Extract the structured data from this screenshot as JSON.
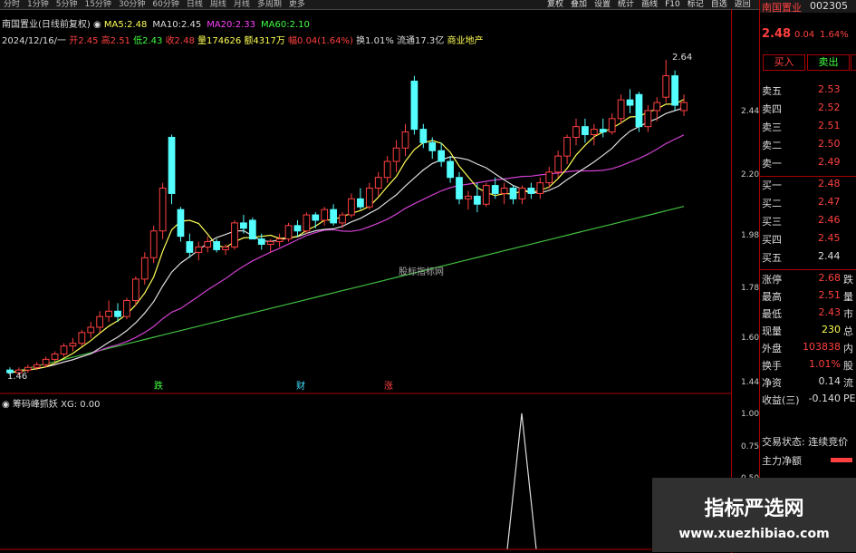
{
  "topbar": {
    "periods": [
      "分时",
      "1分钟",
      "5分钟",
      "15分钟",
      "30分钟",
      "60分钟",
      "日线",
      "周线",
      "月线",
      "多周期",
      "更多"
    ],
    "right_buttons": [
      "复权",
      "叠加",
      "设置",
      "统计",
      "画线",
      "F10",
      "标记",
      "自选",
      "返回"
    ]
  },
  "chart_header": {
    "title": "南国置业(日线前复权)",
    "ma_line": [
      {
        "label": "MA5:",
        "value": "2.48",
        "color": "#ffff55"
      },
      {
        "label": "MA10:",
        "value": "2.45",
        "color": "#dddddd"
      },
      {
        "label": "MA20:",
        "value": "2.33",
        "color": "#ff40ff"
      },
      {
        "label": "MA60:",
        "value": "2.10",
        "color": "#40ff40"
      }
    ],
    "info_line": {
      "date": "2024/12/16/一",
      "open": "开2.45",
      "high": "高2.51",
      "low": "低2.43",
      "close": "收2.48",
      "volume": "量174626",
      "amount": "额4317万",
      "change": "幅0.04(1.64%)",
      "turnover": "换1.01%",
      "float": "流通17.3亿",
      "sector": "商业地产"
    }
  },
  "chart_annotations": {
    "high_label": "2.64",
    "low_label": "1.46",
    "center_watermark": "股标指标网",
    "markers": [
      "跌",
      "财",
      "涨"
    ]
  },
  "y_axis_main": [
    "2.44",
    "2.20",
    "1.98",
    "1.78",
    "1.60",
    "1.44"
  ],
  "y_axis_sub": [
    "1.00",
    "0.75",
    "0.50"
  ],
  "sub_indicator": {
    "name": "筹码峰抓妖",
    "value": "XG: 0.00"
  },
  "chart_data": {
    "type": "candlestick",
    "y_range": [
      1.44,
      2.66
    ],
    "candles": [
      [
        1.48,
        1.49,
        1.46,
        1.47
      ],
      [
        1.47,
        1.49,
        1.46,
        1.48
      ],
      [
        1.48,
        1.5,
        1.47,
        1.49
      ],
      [
        1.49,
        1.51,
        1.48,
        1.5
      ],
      [
        1.5,
        1.53,
        1.49,
        1.52
      ],
      [
        1.52,
        1.55,
        1.51,
        1.54
      ],
      [
        1.54,
        1.58,
        1.53,
        1.57
      ],
      [
        1.57,
        1.6,
        1.55,
        1.58
      ],
      [
        1.58,
        1.63,
        1.57,
        1.62
      ],
      [
        1.62,
        1.66,
        1.6,
        1.64
      ],
      [
        1.64,
        1.7,
        1.62,
        1.68
      ],
      [
        1.68,
        1.74,
        1.66,
        1.7
      ],
      [
        1.7,
        1.73,
        1.66,
        1.68
      ],
      [
        1.68,
        1.75,
        1.67,
        1.74
      ],
      [
        1.74,
        1.83,
        1.72,
        1.82
      ],
      [
        1.82,
        1.92,
        1.8,
        1.9
      ],
      [
        1.9,
        2.02,
        1.88,
        2.0
      ],
      [
        2.0,
        2.18,
        1.97,
        2.16
      ],
      [
        2.35,
        2.36,
        2.1,
        2.14
      ],
      [
        2.08,
        2.09,
        1.96,
        1.98
      ],
      [
        1.96,
        1.99,
        1.9,
        1.92
      ],
      [
        1.92,
        1.96,
        1.89,
        1.94
      ],
      [
        1.94,
        1.98,
        1.92,
        1.96
      ],
      [
        1.96,
        1.97,
        1.92,
        1.93
      ],
      [
        1.93,
        1.95,
        1.91,
        1.94
      ],
      [
        1.94,
        2.04,
        1.93,
        2.03
      ],
      [
        2.03,
        2.06,
        1.99,
        2.01
      ],
      [
        2.04,
        2.05,
        1.97,
        1.97
      ],
      [
        1.97,
        1.99,
        1.93,
        1.95
      ],
      [
        1.95,
        1.97,
        1.92,
        1.96
      ],
      [
        1.96,
        1.99,
        1.94,
        1.97
      ],
      [
        1.97,
        2.03,
        1.96,
        2.02
      ],
      [
        2.02,
        2.04,
        1.98,
        2.0
      ],
      [
        2.0,
        2.07,
        1.99,
        2.06
      ],
      [
        2.06,
        2.07,
        2.01,
        2.04
      ],
      [
        2.04,
        2.09,
        2.02,
        2.08
      ],
      [
        2.08,
        2.1,
        2.02,
        2.03
      ],
      [
        2.03,
        2.07,
        2.01,
        2.06
      ],
      [
        2.06,
        2.14,
        2.05,
        2.12
      ],
      [
        2.12,
        2.16,
        2.08,
        2.09
      ],
      [
        2.09,
        2.18,
        2.08,
        2.16
      ],
      [
        2.16,
        2.22,
        2.13,
        2.2
      ],
      [
        2.2,
        2.28,
        2.18,
        2.26
      ],
      [
        2.26,
        2.34,
        2.22,
        2.31
      ],
      [
        2.31,
        2.4,
        2.28,
        2.37
      ],
      [
        2.56,
        2.58,
        2.36,
        2.38
      ],
      [
        2.38,
        2.4,
        2.31,
        2.33
      ],
      [
        2.33,
        2.35,
        2.27,
        2.3
      ],
      [
        2.3,
        2.33,
        2.24,
        2.26
      ],
      [
        2.26,
        2.28,
        2.18,
        2.2
      ],
      [
        2.2,
        2.22,
        2.1,
        2.12
      ],
      [
        2.12,
        2.15,
        2.08,
        2.13
      ],
      [
        2.13,
        2.18,
        2.07,
        2.1
      ],
      [
        2.1,
        2.18,
        2.09,
        2.17
      ],
      [
        2.17,
        2.2,
        2.12,
        2.14
      ],
      [
        2.14,
        2.18,
        2.1,
        2.16
      ],
      [
        2.16,
        2.17,
        2.1,
        2.12
      ],
      [
        2.12,
        2.17,
        2.1,
        2.16
      ],
      [
        2.16,
        2.18,
        2.12,
        2.14
      ],
      [
        2.14,
        2.2,
        2.12,
        2.18
      ],
      [
        2.18,
        2.24,
        2.16,
        2.22
      ],
      [
        2.22,
        2.3,
        2.2,
        2.28
      ],
      [
        2.28,
        2.36,
        2.25,
        2.35
      ],
      [
        2.35,
        2.42,
        2.32,
        2.39
      ],
      [
        2.39,
        2.42,
        2.33,
        2.36
      ],
      [
        2.36,
        2.4,
        2.32,
        2.38
      ],
      [
        2.38,
        2.42,
        2.35,
        2.37
      ],
      [
        2.37,
        2.44,
        2.36,
        2.42
      ],
      [
        2.42,
        2.51,
        2.4,
        2.49
      ],
      [
        2.49,
        2.53,
        2.44,
        2.47
      ],
      [
        2.51,
        2.52,
        2.37,
        2.39
      ],
      [
        2.39,
        2.47,
        2.37,
        2.45
      ],
      [
        2.45,
        2.5,
        2.41,
        2.48
      ],
      [
        2.5,
        2.64,
        2.48,
        2.58
      ],
      [
        2.58,
        2.6,
        2.45,
        2.47
      ],
      [
        2.45,
        2.51,
        2.43,
        2.48
      ]
    ]
  },
  "quote_panel": {
    "stock_name": "南国置业",
    "stock_code": "002305",
    "price": "2.48",
    "change": "0.04",
    "change_pct": "1.64%",
    "buy_btn": "买入",
    "sell_btn": "卖出",
    "asks": [
      {
        "label": "卖五",
        "price": "2.53"
      },
      {
        "label": "卖四",
        "price": "2.52"
      },
      {
        "label": "卖三",
        "price": "2.51"
      },
      {
        "label": "卖二",
        "price": "2.50"
      },
      {
        "label": "卖一",
        "price": "2.49"
      }
    ],
    "bids": [
      {
        "label": "买一",
        "price": "2.48"
      },
      {
        "label": "买二",
        "price": "2.47"
      },
      {
        "label": "买三",
        "price": "2.46"
      },
      {
        "label": "买四",
        "price": "2.45"
      },
      {
        "label": "买五",
        "price": "2.44"
      }
    ],
    "stats": [
      {
        "label": "涨停",
        "value": "2.68",
        "tail": "跌"
      },
      {
        "label": "最高",
        "value": "2.51",
        "tail": "量"
      },
      {
        "label": "最低",
        "value": "2.43",
        "tail": "市"
      },
      {
        "label": "现量",
        "value": "230",
        "tail": "总"
      },
      {
        "label": "外盘",
        "value": "103838",
        "tail": "内"
      },
      {
        "label": "换手",
        "value": "1.01%",
        "tail": "股"
      },
      {
        "label": "净资",
        "value": "0.14",
        "tail": "流"
      },
      {
        "label": "收益(三)",
        "value": "-0.140",
        "tail": "PE"
      }
    ],
    "trade_status": "交易状态: 连续竞价",
    "main_net": "主力净额"
  },
  "watermark": {
    "title": "指标严选网",
    "url": "www.xuezhibiao.com"
  }
}
